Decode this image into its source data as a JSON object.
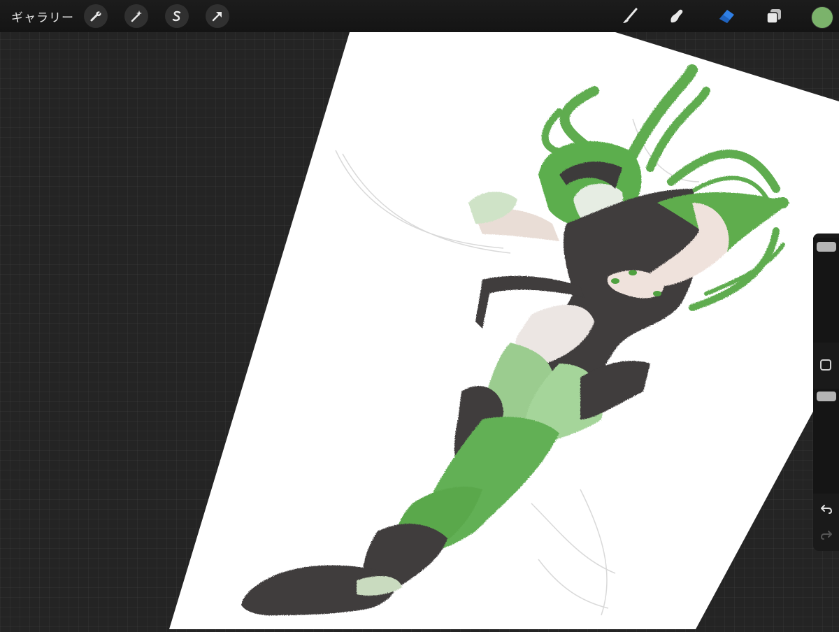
{
  "toolbar": {
    "gallery_label": "ギャラリー",
    "left_tools": [
      {
        "name": "actions",
        "icon": "wrench-icon"
      },
      {
        "name": "adjustments",
        "icon": "magic-wand-icon"
      },
      {
        "name": "selection",
        "icon": "selection-s-icon"
      },
      {
        "name": "transform",
        "icon": "arrow-cursor-icon"
      }
    ],
    "right_tools": [
      {
        "name": "brush",
        "icon": "brush-icon",
        "active": false
      },
      {
        "name": "smudge",
        "icon": "smudge-finger-icon",
        "active": false
      },
      {
        "name": "eraser",
        "icon": "eraser-icon",
        "active": true
      },
      {
        "name": "layers",
        "icon": "layers-icon",
        "active": false
      }
    ],
    "current_color": "#7bb36b"
  },
  "sidebar": {
    "brush_size_icon": "slider-thumb",
    "modifier_icon": "square-modifier-icon",
    "undo_icon": "undo-icon",
    "redo_icon": "redo-icon"
  },
  "colors": {
    "accent": "#2f7fe6",
    "background": "#242424",
    "paint_green": "#5daa4e",
    "paint_dark": "#3e3b3b"
  }
}
